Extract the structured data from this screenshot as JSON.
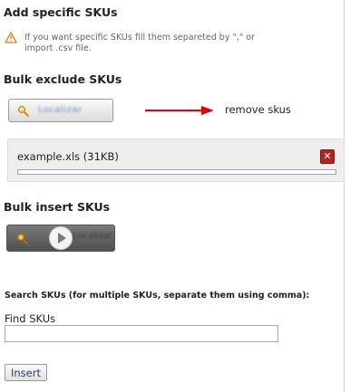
{
  "add_section": {
    "title": "Add specific SKUs",
    "warning_line1": "If you want specific SKUs fill them separeted by \",\" or",
    "warning_line2": "import .csv file."
  },
  "bulk_exclude": {
    "title": "Bulk exclude SKUs",
    "locate_label": "Localizar",
    "annotation": "remove skus",
    "file_name": "example.xls (31KB)",
    "upload_progress": 0,
    "close_symbol": "✕"
  },
  "bulk_insert": {
    "title": "Bulk insert SKUs",
    "locate_label": "Localizar"
  },
  "search": {
    "instruction": "Search SKUs (for multiple SKUs, separate them using comma):",
    "field_label": "Find SKUs",
    "value": "",
    "placeholder": "",
    "insert_label": "Insert"
  },
  "colors": {
    "annotation_arrow": "#e00000",
    "warning_icon": "#e07820",
    "close_button": "#b32424"
  }
}
